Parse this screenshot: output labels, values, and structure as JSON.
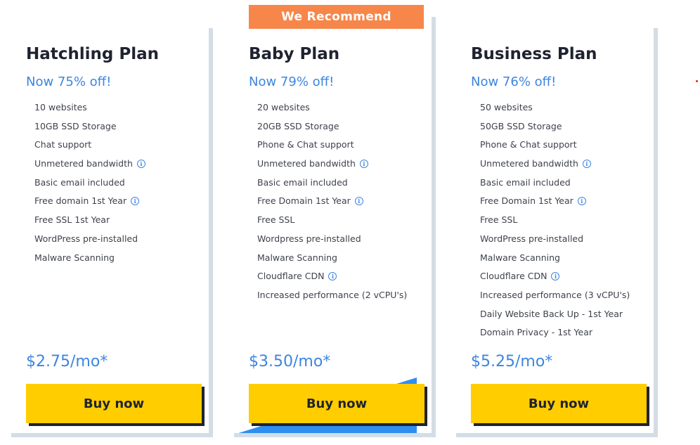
{
  "badge": "We Recommend",
  "plans": [
    {
      "title": "Hatchling Plan",
      "discount": "Now 75% off!",
      "features": [
        {
          "text": "10 websites",
          "info": false
        },
        {
          "text": "10GB SSD Storage",
          "info": false
        },
        {
          "text": "Chat support",
          "info": false
        },
        {
          "text": "Unmetered bandwidth",
          "info": true
        },
        {
          "text": "Basic email included",
          "info": false
        },
        {
          "text": "Free domain 1st Year",
          "info": true
        },
        {
          "text": "Free SSL 1st Year",
          "info": false
        },
        {
          "text": "WordPress pre-installed",
          "info": false
        },
        {
          "text": "Malware Scanning",
          "info": false
        }
      ],
      "price": "$2.75/mo*",
      "button": "Buy now"
    },
    {
      "title": "Baby Plan",
      "discount": "Now 79% off!",
      "features": [
        {
          "text": "20 websites",
          "info": false
        },
        {
          "text": "20GB SSD Storage",
          "info": false
        },
        {
          "text": "Phone & Chat support",
          "info": false
        },
        {
          "text": "Unmetered bandwidth",
          "info": true
        },
        {
          "text": "Basic email included",
          "info": false
        },
        {
          "text": "Free Domain 1st Year",
          "info": true
        },
        {
          "text": "Free SSL",
          "info": false
        },
        {
          "text": "Wordpress pre-installed",
          "info": false
        },
        {
          "text": "Malware Scanning",
          "info": false
        },
        {
          "text": "Cloudflare CDN",
          "info": true
        },
        {
          "text": "Increased performance (2 vCPU's)",
          "info": false
        }
      ],
      "price": "$3.50/mo*",
      "button": "Buy now"
    },
    {
      "title": "Business Plan",
      "discount": "Now 76% off!",
      "features": [
        {
          "text": "50 websites",
          "info": false
        },
        {
          "text": "50GB SSD Storage",
          "info": false
        },
        {
          "text": "Phone & Chat support",
          "info": false
        },
        {
          "text": "Unmetered bandwidth",
          "info": true
        },
        {
          "text": "Basic email included",
          "info": false
        },
        {
          "text": "Free Domain 1st Year",
          "info": true
        },
        {
          "text": "Free SSL",
          "info": false
        },
        {
          "text": "WordPress pre-installed",
          "info": false
        },
        {
          "text": "Malware Scanning",
          "info": false
        },
        {
          "text": "Cloudflare CDN",
          "info": true
        },
        {
          "text": "Increased performance (3 vCPU's)",
          "info": false
        },
        {
          "text": "Daily Website Back Up - 1st Year",
          "info": false
        },
        {
          "text": "Domain Privacy - 1st Year",
          "info": false
        }
      ],
      "price": "$5.25/mo*",
      "button": "Buy now"
    }
  ],
  "colors": {
    "accent_blue": "#3d85e0",
    "badge_orange": "#f6864a",
    "button_yellow": "#ffcd00",
    "text_dark": "#1f2330",
    "card_border": "#d3dde6",
    "highlight_blue": "#2e8ff0"
  },
  "icons": {
    "info": "info-icon"
  }
}
